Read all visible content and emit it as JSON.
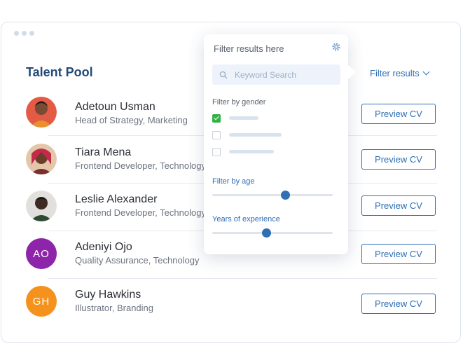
{
  "header": {
    "title": "Talent Pool",
    "filter_label": "Filter results"
  },
  "candidates": [
    {
      "name": "Adetoun Usman",
      "role": "Head of Strategy, Marketing",
      "button": "Preview CV",
      "avatar": {
        "type": "photo",
        "color": "#c7584a"
      }
    },
    {
      "name": "Tiara Mena",
      "role": "Frontend Developer, Technology",
      "button": "Preview CV",
      "avatar": {
        "type": "photo",
        "color": "#a04a6a"
      }
    },
    {
      "name": "Leslie Alexander",
      "role": "Frontend Developer, Technology",
      "button": "Preview CV",
      "avatar": {
        "type": "photo",
        "color": "#4b3a30"
      }
    },
    {
      "name": "Adeniyi Ojo",
      "role": "Quality Assurance, Technology",
      "button": "Preview CV",
      "avatar": {
        "type": "initials",
        "initials": "AO",
        "color": "#8e24aa"
      }
    },
    {
      "name": "Guy Hawkins",
      "role": "Illustrator, Branding",
      "button": "Preview CV",
      "avatar": {
        "type": "initials",
        "initials": "GH",
        "color": "#f5921e"
      }
    }
  ],
  "filter_panel": {
    "title": "Filter results here",
    "search_placeholder": "Keyword Search",
    "gender_label": "Filter by gender",
    "gender_options": [
      {
        "checked": true
      },
      {
        "checked": false
      },
      {
        "checked": false
      }
    ],
    "age_label": "Filter by age",
    "age_level": 0.61,
    "experience_label": "Years of experience",
    "experience_level": 0.45
  },
  "colors": {
    "accent": "#2f6fb5",
    "title": "#244a78",
    "check": "#2fb344"
  }
}
